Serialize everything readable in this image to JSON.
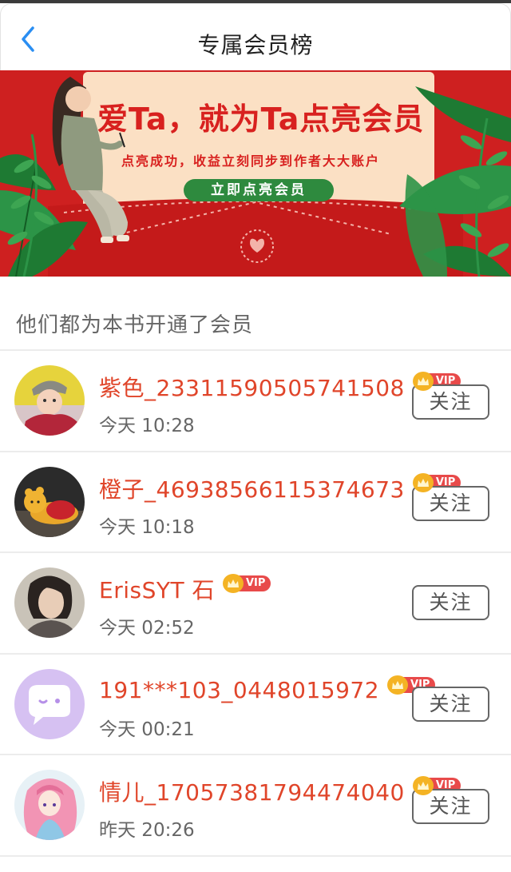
{
  "header": {
    "title": "专属会员榜"
  },
  "banner": {
    "headline": "爱Ta，就为Ta点亮会员",
    "subline": "点亮成功，收益立刻同步到作者大大账户",
    "cta_label": "立即点亮会员"
  },
  "section": {
    "title": "他们都为本书开通了会员"
  },
  "members": [
    {
      "name": "紫色_23311590505741508",
      "time": "今天 10:28",
      "badge": "VIP",
      "follow_label": "关注",
      "avatar": "baby-photo"
    },
    {
      "name": "橙子_46938566115374673",
      "time": "今天 10:18",
      "badge": "VIP",
      "follow_label": "关注",
      "avatar": "pooh-plush"
    },
    {
      "name": "ErisSYT 石",
      "time": "今天 02:52",
      "badge": "VIP",
      "follow_label": "关注",
      "avatar": "person-portrait"
    },
    {
      "name": "191***103_0448015972",
      "time": "今天 00:21",
      "badge": "VIP",
      "follow_label": "关注",
      "avatar": "chat-bubble"
    },
    {
      "name": "情儿_17057381794474040",
      "time": "昨天 20:26",
      "badge": "VIP",
      "follow_label": "关注",
      "avatar": "anime-girl"
    }
  ],
  "colors": {
    "accent": "#e0452a",
    "banner_red": "#c91c1c",
    "cta_green": "#2e8a3e",
    "vip_red": "#e84a4a",
    "crown_gold": "#f4b324"
  }
}
